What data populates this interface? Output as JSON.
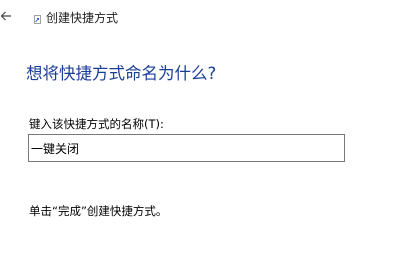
{
  "window": {
    "title": "创建快捷方式"
  },
  "icons": {
    "back": "back-arrow-icon",
    "shortcut": "shortcut-icon"
  },
  "page": {
    "heading": "想将快捷方式命名为什么?",
    "field_label": "键入该快捷方式的名称(T):",
    "name_value": "一键关闭",
    "instruction": "单击“完成”创建快捷方式。"
  },
  "colors": {
    "heading": "#1a3f95",
    "input_border": "#7a7a7a",
    "background": "#ffffff"
  }
}
